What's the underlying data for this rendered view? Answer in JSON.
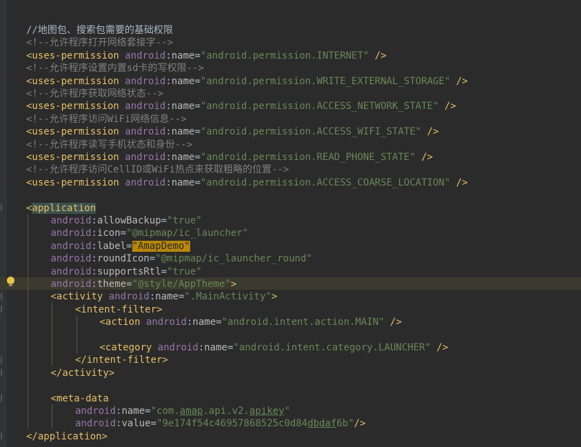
{
  "lines": [
    {
      "row": 0,
      "indent": 0,
      "tokens": [
        [
          "plain",
          "//地图包、搜索包需要的基础权限"
        ]
      ]
    },
    {
      "row": 1,
      "indent": 0,
      "tokens": [
        [
          "comment",
          "<!--允许程序打开网络套接字-->"
        ]
      ]
    },
    {
      "row": 2,
      "indent": 0,
      "tokens": [
        [
          "tag",
          "<uses-permission"
        ],
        [
          "plain",
          " "
        ],
        [
          "ns",
          "android"
        ],
        [
          "punc",
          ":"
        ],
        [
          "attr",
          "name"
        ],
        [
          "punc",
          "="
        ],
        [
          "val",
          "\"android.permission.INTERNET\""
        ],
        [
          "plain",
          " "
        ],
        [
          "tag",
          "/>"
        ]
      ]
    },
    {
      "row": 3,
      "indent": 0,
      "tokens": [
        [
          "comment",
          "<!--允许程序设置内置sd卡的写权限-->"
        ]
      ]
    },
    {
      "row": 4,
      "indent": 0,
      "tokens": [
        [
          "tag",
          "<uses-permission"
        ],
        [
          "plain",
          " "
        ],
        [
          "ns",
          "android"
        ],
        [
          "punc",
          ":"
        ],
        [
          "attr",
          "name"
        ],
        [
          "punc",
          "="
        ],
        [
          "val",
          "\"android.permission.WRITE_EXTERNAL_STORAGE\""
        ],
        [
          "plain",
          " "
        ],
        [
          "tag",
          "/>"
        ]
      ]
    },
    {
      "row": 5,
      "indent": 0,
      "tokens": [
        [
          "comment",
          "<!--允许程序获取网络状态-->"
        ]
      ]
    },
    {
      "row": 6,
      "indent": 0,
      "tokens": [
        [
          "tag",
          "<uses-permission"
        ],
        [
          "plain",
          " "
        ],
        [
          "ns",
          "android"
        ],
        [
          "punc",
          ":"
        ],
        [
          "attr",
          "name"
        ],
        [
          "punc",
          "="
        ],
        [
          "val",
          "\"android.permission.ACCESS_NETWORK_STATE\""
        ],
        [
          "plain",
          " "
        ],
        [
          "tag",
          "/>"
        ]
      ]
    },
    {
      "row": 7,
      "indent": 0,
      "tokens": [
        [
          "comment",
          "<!--允许程序访问WiFi网络信息-->"
        ]
      ]
    },
    {
      "row": 8,
      "indent": 0,
      "tokens": [
        [
          "tag",
          "<uses-permission"
        ],
        [
          "plain",
          " "
        ],
        [
          "ns",
          "android"
        ],
        [
          "punc",
          ":"
        ],
        [
          "attr",
          "name"
        ],
        [
          "punc",
          "="
        ],
        [
          "val",
          "\"android.permission.ACCESS_WIFI_STATE\""
        ],
        [
          "plain",
          " "
        ],
        [
          "tag",
          "/>"
        ]
      ]
    },
    {
      "row": 9,
      "indent": 0,
      "tokens": [
        [
          "comment",
          "<!--允许程序读写手机状态和身份-->"
        ]
      ]
    },
    {
      "row": 10,
      "indent": 0,
      "tokens": [
        [
          "tag",
          "<uses-permission"
        ],
        [
          "plain",
          " "
        ],
        [
          "ns",
          "android"
        ],
        [
          "punc",
          ":"
        ],
        [
          "attr",
          "name"
        ],
        [
          "punc",
          "="
        ],
        [
          "val",
          "\"android.permission.READ_PHONE_STATE\""
        ],
        [
          "plain",
          " "
        ],
        [
          "tag",
          "/>"
        ]
      ]
    },
    {
      "row": 11,
      "indent": 0,
      "tokens": [
        [
          "comment",
          "<!--允许程序访问CellID或WiFi热点来获取粗略的位置-->"
        ]
      ]
    },
    {
      "row": 12,
      "indent": 0,
      "tokens": [
        [
          "tag",
          "<uses-permission"
        ],
        [
          "plain",
          " "
        ],
        [
          "ns",
          "android"
        ],
        [
          "punc",
          ":"
        ],
        [
          "attr",
          "name"
        ],
        [
          "punc",
          "="
        ],
        [
          "val",
          "\"android.permission.ACCESS_COARSE_LOCATION\""
        ],
        [
          "plain",
          " "
        ],
        [
          "tag",
          "/>"
        ]
      ]
    },
    {
      "row": 14,
      "indent": 0,
      "tokens": [
        [
          "tag",
          "<"
        ],
        [
          "match",
          "application"
        ]
      ]
    },
    {
      "row": 15,
      "indent": 1,
      "tokens": [
        [
          "ns",
          "android"
        ],
        [
          "punc",
          ":"
        ],
        [
          "attr",
          "allowBackup"
        ],
        [
          "punc",
          "="
        ],
        [
          "val",
          "\"true\""
        ]
      ]
    },
    {
      "row": 16,
      "indent": 1,
      "tokens": [
        [
          "ns",
          "android"
        ],
        [
          "punc",
          ":"
        ],
        [
          "attr",
          "icon"
        ],
        [
          "punc",
          "="
        ],
        [
          "val",
          "\"@mipmap/ic_launcher\""
        ]
      ]
    },
    {
      "row": 17,
      "indent": 1,
      "tokens": [
        [
          "ns",
          "android"
        ],
        [
          "punc",
          ":"
        ],
        [
          "attr",
          "label"
        ],
        [
          "punc",
          "="
        ],
        [
          "found",
          "\"AmapDemo\""
        ]
      ]
    },
    {
      "row": 18,
      "indent": 1,
      "tokens": [
        [
          "ns",
          "android"
        ],
        [
          "punc",
          ":"
        ],
        [
          "attr",
          "roundIcon"
        ],
        [
          "punc",
          "="
        ],
        [
          "val",
          "\"@mipmap/ic_launcher_round\""
        ]
      ]
    },
    {
      "row": 19,
      "indent": 1,
      "tokens": [
        [
          "ns",
          "android"
        ],
        [
          "punc",
          ":"
        ],
        [
          "attr",
          "supportsRtl"
        ],
        [
          "punc",
          "="
        ],
        [
          "val",
          "\"true\""
        ]
      ]
    },
    {
      "row": 20,
      "indent": 1,
      "tokens": [
        [
          "ns",
          "android"
        ],
        [
          "punc",
          ":"
        ],
        [
          "attr",
          "theme"
        ],
        [
          "punc",
          "="
        ],
        [
          "val",
          "\"@style/AppTheme\""
        ],
        [
          "tag",
          ">"
        ]
      ]
    },
    {
      "row": 21,
      "indent": 1,
      "tokens": [
        [
          "tag",
          "<activity"
        ],
        [
          "plain",
          " "
        ],
        [
          "ns",
          "android"
        ],
        [
          "punc",
          ":"
        ],
        [
          "attr",
          "name"
        ],
        [
          "punc",
          "="
        ],
        [
          "val",
          "\".MainActivity\""
        ],
        [
          "tag",
          ">"
        ]
      ]
    },
    {
      "row": 22,
      "indent": 2,
      "tokens": [
        [
          "tag",
          "<intent-filter>"
        ]
      ]
    },
    {
      "row": 23,
      "indent": 3,
      "tokens": [
        [
          "tag",
          "<action"
        ],
        [
          "plain",
          " "
        ],
        [
          "ns",
          "android"
        ],
        [
          "punc",
          ":"
        ],
        [
          "attr",
          "name"
        ],
        [
          "punc",
          "="
        ],
        [
          "val",
          "\"android.intent.action.MAIN\""
        ],
        [
          "plain",
          " "
        ],
        [
          "tag",
          "/>"
        ]
      ]
    },
    {
      "row": 25,
      "indent": 3,
      "tokens": [
        [
          "tag",
          "<category"
        ],
        [
          "plain",
          " "
        ],
        [
          "ns",
          "android"
        ],
        [
          "punc",
          ":"
        ],
        [
          "attr",
          "name"
        ],
        [
          "punc",
          "="
        ],
        [
          "val",
          "\"android.intent.category.LAUNCHER\""
        ],
        [
          "plain",
          " "
        ],
        [
          "tag",
          "/>"
        ]
      ]
    },
    {
      "row": 26,
      "indent": 2,
      "tokens": [
        [
          "tag",
          "</intent-filter>"
        ]
      ]
    },
    {
      "row": 27,
      "indent": 1,
      "tokens": [
        [
          "tag",
          "</activity>"
        ]
      ]
    },
    {
      "row": 29,
      "indent": 1,
      "tokens": [
        [
          "tag",
          "<meta-data"
        ]
      ]
    },
    {
      "row": 30,
      "indent": 2,
      "tokens": [
        [
          "ns",
          "android"
        ],
        [
          "punc",
          ":"
        ],
        [
          "attr",
          "name"
        ],
        [
          "punc",
          "="
        ],
        [
          "val",
          "\"com."
        ],
        [
          "valu",
          "amap"
        ],
        [
          "val",
          ".api.v2."
        ],
        [
          "valu",
          "apikey"
        ],
        [
          "val",
          "\""
        ]
      ]
    },
    {
      "row": 31,
      "indent": 2,
      "tokens": [
        [
          "ns",
          "android"
        ],
        [
          "punc",
          ":"
        ],
        [
          "attr",
          "value"
        ],
        [
          "punc",
          "="
        ],
        [
          "val",
          "\"9e174f54c46957868525c0d84"
        ],
        [
          "valu",
          "dbdaf"
        ],
        [
          "val",
          "6b\""
        ],
        [
          "tag",
          "/>"
        ]
      ]
    },
    {
      "row": 32,
      "indent": 0,
      "tokens": [
        [
          "tag",
          "</application>"
        ]
      ]
    }
  ]
}
